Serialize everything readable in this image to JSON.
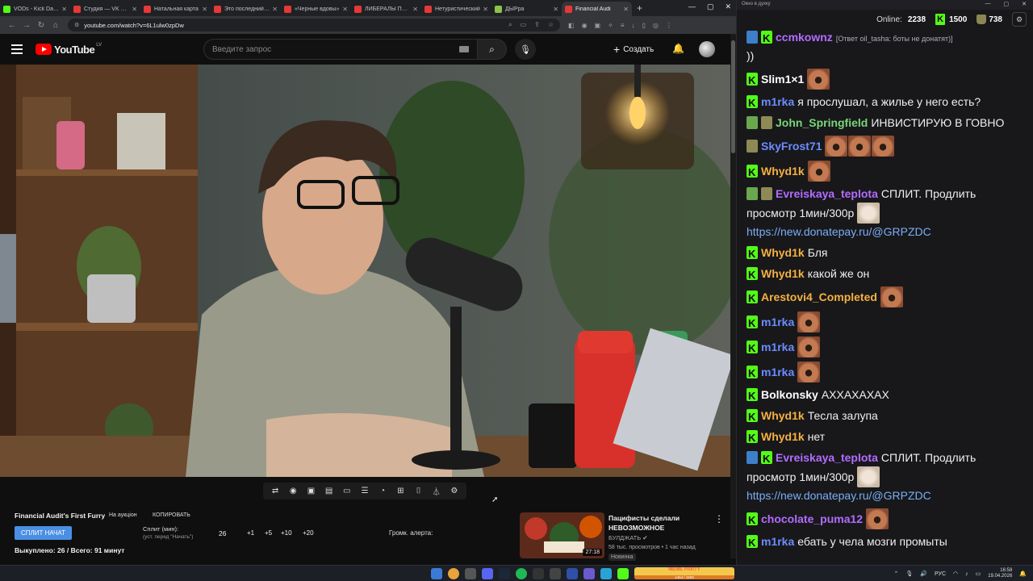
{
  "browser": {
    "tabs": [
      {
        "title": "VODs - Kick Dashb",
        "color": "#53fc18"
      },
      {
        "title": "Студия — VK Видео",
        "color": "#e53935"
      },
      {
        "title": "Натальная карта",
        "color": "#e53935"
      },
      {
        "title": "Это последний го",
        "color": "#e53935"
      },
      {
        "title": "«Черные вдовы»",
        "color": "#e53935"
      },
      {
        "title": "ЛИБЕРАЛЫ ПРАВЫ",
        "color": "#e53935"
      },
      {
        "title": "Нетуристический",
        "color": "#e53935"
      },
      {
        "title": "ДЫРра",
        "color": "#8bc34a"
      },
      {
        "title": "Financial Audi",
        "color": "#e53935",
        "active": true
      }
    ],
    "url": "youtube.com/watch?v=6L1ulw0zpDw"
  },
  "youtube": {
    "logo_text": "YouTube",
    "country_code": "LV",
    "search_placeholder": "Введите запрос",
    "create_label": "Создать"
  },
  "auction": {
    "title": "Financial Audit's First Furry",
    "tag": "На аукціон",
    "copy_label": "КОПИРОВАТЬ",
    "split_button": "СПЛИТ НАЧАТ",
    "split_label": "Сплит (мин):",
    "split_hint": "(уст. перед \"Начать\")",
    "split_value": "26",
    "increments": [
      "+1",
      "+5",
      "+10",
      "+20"
    ],
    "alert_label": "Громк. алерта:",
    "sold_text": "Выкуплено: 26 / Всего: 91 минут"
  },
  "recommended": {
    "title": "Пацифисты сделали НЕВОЗМОЖНОЕ",
    "channel": "БУЛДЖАТЬ",
    "stats": "58 тыс. просмотров • 1 час назад",
    "badge": "Новинка",
    "duration": "27:18"
  },
  "chat": {
    "window_title": "Окно в духку",
    "online_label": "Online:",
    "online_count": "2238",
    "kick_count": "1500",
    "cup_count": "738",
    "messages": [
      {
        "user": "ccmkownz",
        "color": "#b36cff",
        "badges": [
          "sword",
          "kick"
        ],
        "reply": "[Ответ oil_tasha: боты не донатят)]",
        "text": "))"
      },
      {
        "user": "Slim1×1",
        "color": "#ffffff",
        "badges": [
          "kick"
        ],
        "emotes": 1
      },
      {
        "user": "m1rka",
        "color": "#6c8cff",
        "badges": [
          "kick"
        ],
        "text": "я прослушал, а жилье у него есть?"
      },
      {
        "user": "John_Springfield",
        "color": "#7ad67a",
        "badges": [
          "mod",
          "cup"
        ],
        "text": "ИНВИСТИРУЮ В ГОВНО"
      },
      {
        "user": "SkyFrost71",
        "color": "#6c8cff",
        "badges": [
          "cup"
        ],
        "emotes": 3
      },
      {
        "user": "Whyd1k",
        "color": "#f5b041",
        "badges": [
          "kick"
        ],
        "emotes": 1
      },
      {
        "user": "Evreiskaya_teplota",
        "color": "#b36cff",
        "badges": [
          "mod",
          "cup"
        ],
        "text": "СПЛИТ. Продлить просмотр 1мин/300р",
        "pale": true,
        "link": "https://new.donatepay.ru/@GRPZDC"
      },
      {
        "user": "Whyd1k",
        "color": "#f5b041",
        "badges": [
          "kick"
        ],
        "text": "Бля"
      },
      {
        "user": "Whyd1k",
        "color": "#f5b041",
        "badges": [
          "kick"
        ],
        "text": "какой же он"
      },
      {
        "user": "Arestovi4_Completed",
        "color": "#f5b041",
        "badges": [
          "kick"
        ],
        "emotes": 1
      },
      {
        "user": "m1rka",
        "color": "#6c8cff",
        "badges": [
          "kick"
        ],
        "emotes": 1
      },
      {
        "user": "m1rka",
        "color": "#6c8cff",
        "badges": [
          "kick"
        ],
        "emotes": 1
      },
      {
        "user": "m1rka",
        "color": "#6c8cff",
        "badges": [
          "kick"
        ],
        "emotes": 1
      },
      {
        "user": "Bolkonsky",
        "color": "#ffffff",
        "badges": [
          "kick"
        ],
        "text": "АХХАХАХАХ"
      },
      {
        "user": "Whyd1k",
        "color": "#f5b041",
        "badges": [
          "kick"
        ],
        "text": "Тесла залупа"
      },
      {
        "user": "Whyd1k",
        "color": "#f5b041",
        "badges": [
          "kick"
        ],
        "text": "нет"
      },
      {
        "user": "Evreiskaya_teplota",
        "color": "#b36cff",
        "badges": [
          "sword",
          "kick"
        ],
        "text": "СПЛИТ. Продлить просмотр 1мин/300р",
        "pale": true,
        "link": "https://new.donatepay.ru/@GRPZDC"
      },
      {
        "user": "chocolate_puma12",
        "color": "#b36cff",
        "badges": [
          "kick"
        ],
        "emotes": 1
      },
      {
        "user": "m1rka",
        "color": "#6c8cff",
        "badges": [
          "kick"
        ],
        "text": "ебать у чела мозги промыты"
      }
    ]
  },
  "taskbar": {
    "meme_label": "MEME PARTY",
    "meme_value": "1454 / 1500",
    "lang": "РУС",
    "time": "16:58",
    "date": "19.04.2026"
  }
}
